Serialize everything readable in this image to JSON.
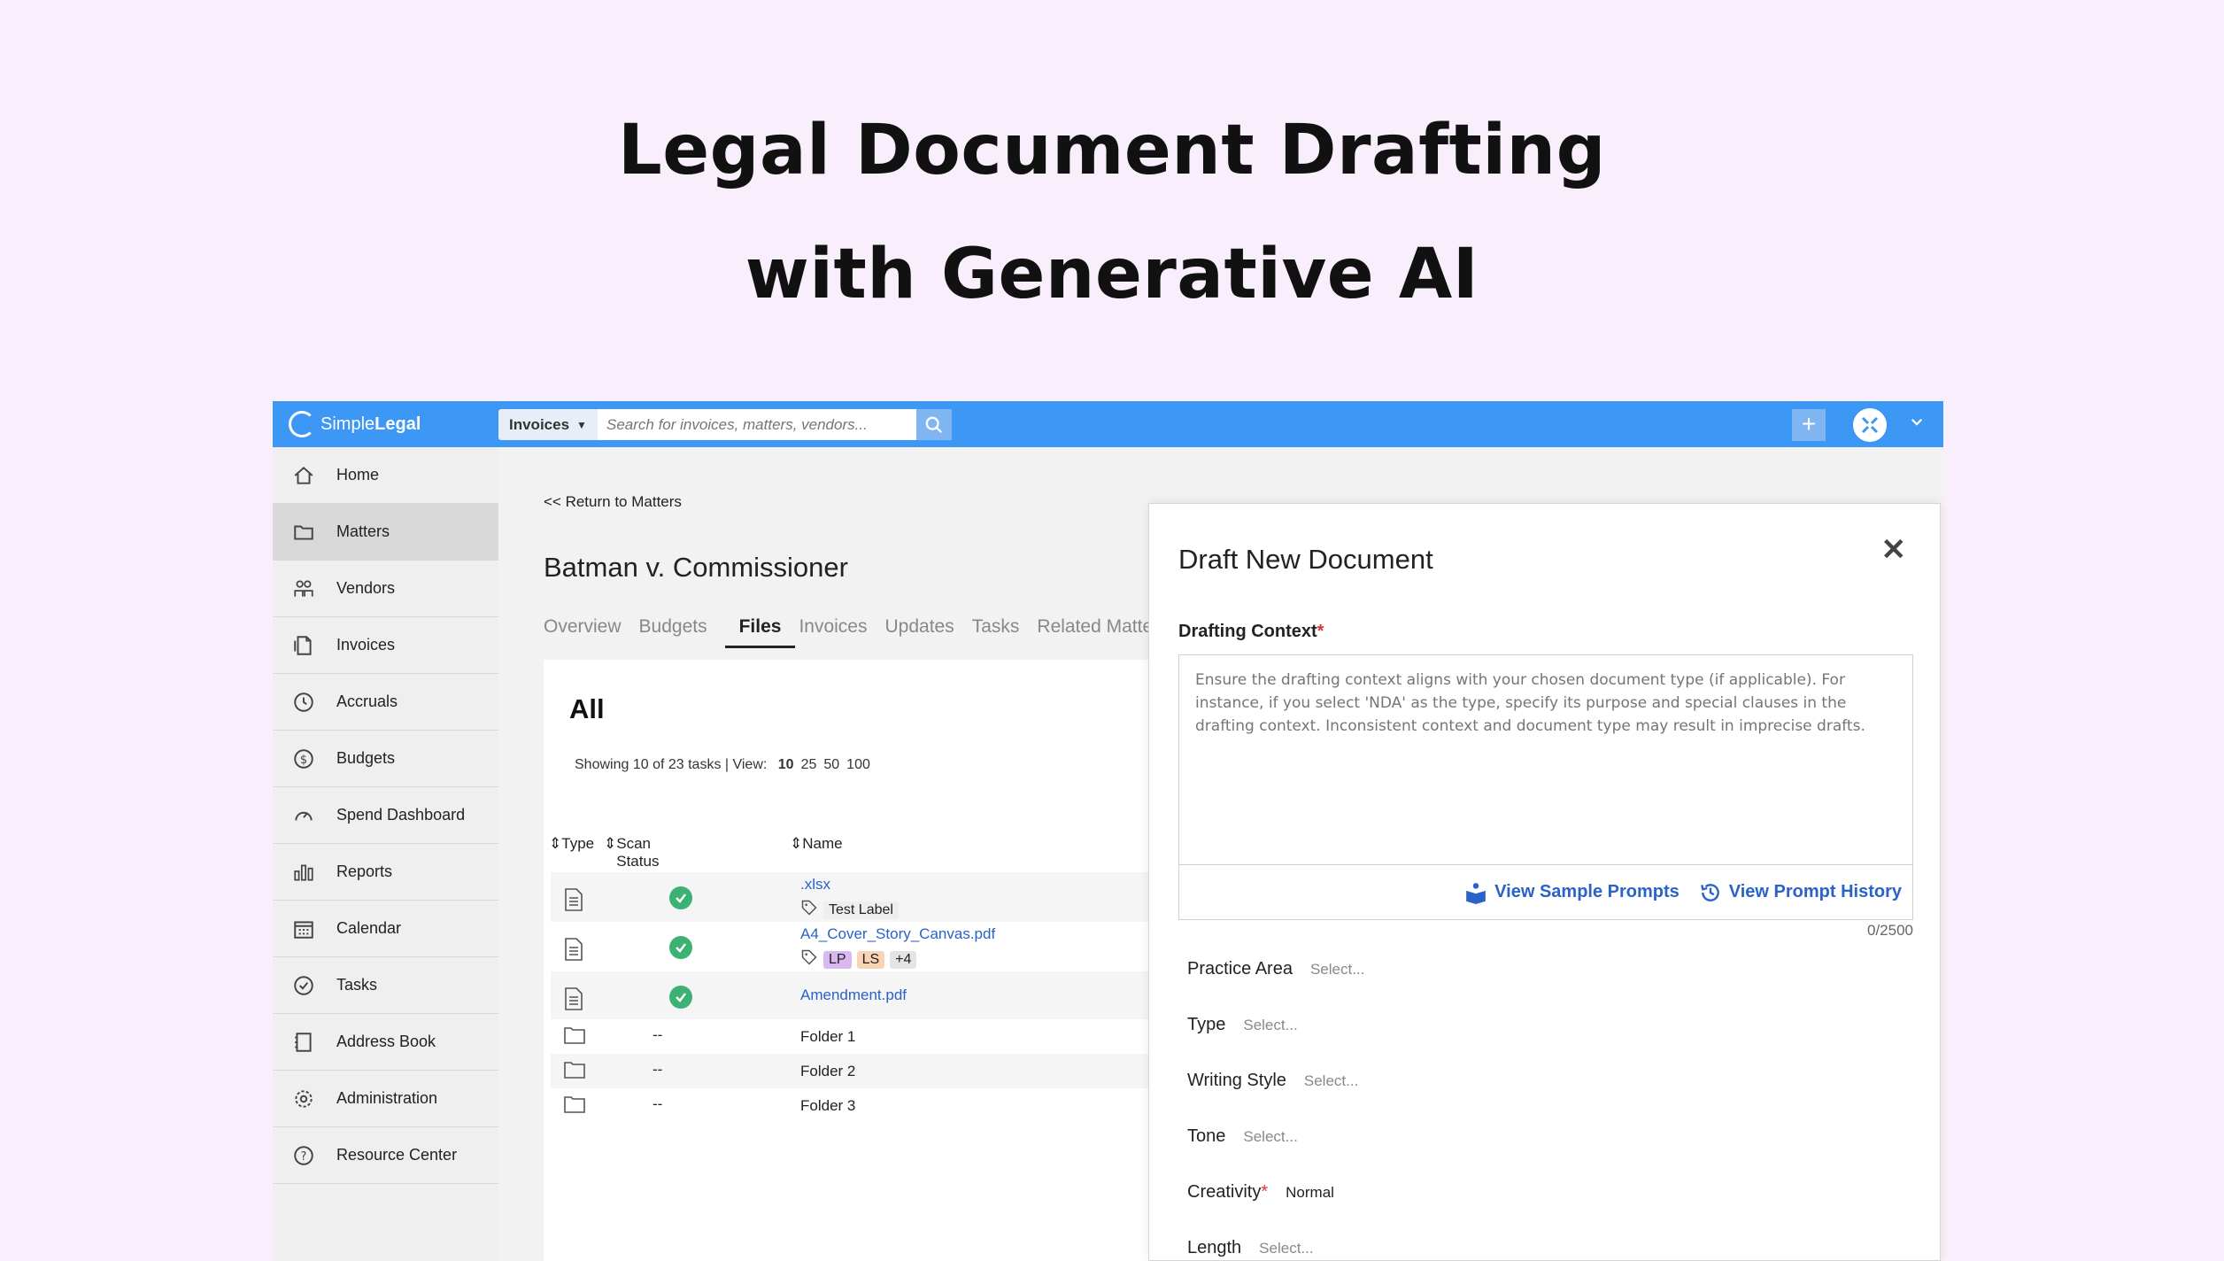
{
  "hero": {
    "line1": "Legal Document Drafting",
    "line2": "with Generative AI"
  },
  "topbar": {
    "brand_light": "Simple",
    "brand_bold": "Legal",
    "search_scope": "Invoices",
    "search_placeholder": "Search for invoices, matters, vendors..."
  },
  "sidebar": {
    "items": [
      {
        "label": "Home",
        "icon": "home-icon"
      },
      {
        "label": "Matters",
        "icon": "folder-icon",
        "active": true
      },
      {
        "label": "Vendors",
        "icon": "people-icon"
      },
      {
        "label": "Invoices",
        "icon": "invoice-icon"
      },
      {
        "label": "Accruals",
        "icon": "clock-icon"
      },
      {
        "label": "Budgets",
        "icon": "dollar-icon"
      },
      {
        "label": "Spend Dashboard",
        "icon": "gauge-icon"
      },
      {
        "label": "Reports",
        "icon": "bar-chart-icon"
      },
      {
        "label": "Calendar",
        "icon": "calendar-icon"
      },
      {
        "label": "Tasks",
        "icon": "check-circle-icon"
      },
      {
        "label": "Address Book",
        "icon": "book-icon"
      },
      {
        "label": "Administration",
        "icon": "gear-icon"
      },
      {
        "label": "Resource Center",
        "icon": "help-icon"
      }
    ]
  },
  "matter": {
    "return_link": "<< Return to Matters",
    "title": "Batman v. Commissioner",
    "tabs": [
      "Overview",
      "Budgets",
      "Files",
      "Invoices",
      "Updates",
      "Tasks",
      "Related Matters"
    ],
    "active_tab": "Files"
  },
  "files": {
    "heading": "All",
    "showing": "Showing 10 of 23 tasks | View:",
    "view_options": [
      "10",
      "25",
      "50",
      "100"
    ],
    "columns": {
      "type": "Type",
      "scan_status": "Scan Status",
      "name": "Name"
    },
    "rows": [
      {
        "name": ".xlsx",
        "status": "ok",
        "tags": [
          "Test Label"
        ]
      },
      {
        "name": "A4_Cover_Story_Canvas.pdf",
        "status": "ok",
        "tags": [
          "LP",
          "LS",
          "+4"
        ]
      },
      {
        "name": "Amendment.pdf",
        "status": "ok",
        "tags": []
      },
      {
        "name": "Folder 1",
        "status": "--"
      },
      {
        "name": "Folder 2",
        "status": "--"
      },
      {
        "name": "Folder 3",
        "status": "--"
      }
    ]
  },
  "draft": {
    "title": "Draft New Document",
    "context_label": "Drafting Context",
    "context_placeholder": "Ensure the drafting context aligns with your chosen document type (if applicable). For instance, if you select 'NDA' as the type, specify its purpose and special clauses in the drafting context. Inconsistent context and document type may result in imprecise drafts.",
    "sample_prompts": "View Sample Prompts",
    "prompt_history": "View Prompt History",
    "counter": "0/2500",
    "fields": {
      "practice_area": {
        "label": "Practice Area",
        "value": "Select..."
      },
      "type": {
        "label": "Type",
        "value": "Select..."
      },
      "writing_style": {
        "label": "Writing Style",
        "value": "Select..."
      },
      "tone": {
        "label": "Tone",
        "value": "Select..."
      },
      "creativity": {
        "label": "Creativity",
        "value": "Normal"
      },
      "length": {
        "label": "Length",
        "value": "Select..."
      }
    }
  }
}
